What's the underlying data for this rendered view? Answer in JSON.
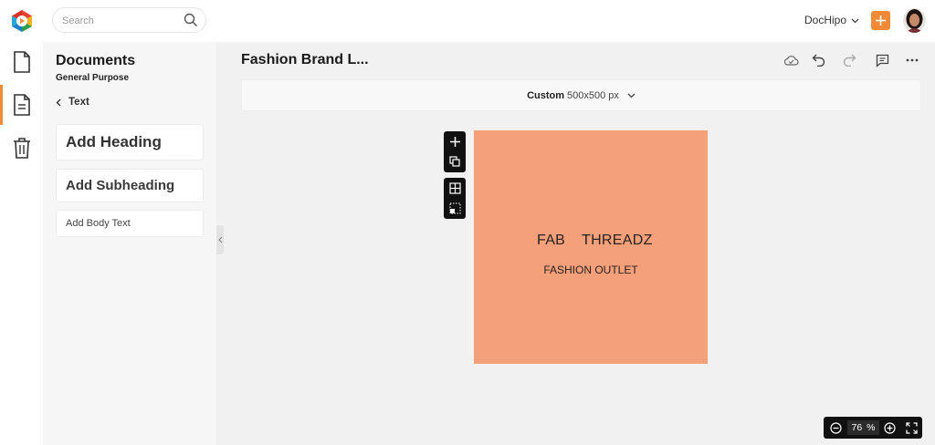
{
  "topbar": {
    "search_placeholder": "Search",
    "team_label": "DocHipo",
    "accent_color": "#f08a36"
  },
  "rail": {
    "items": [
      {
        "icon": "document-icon",
        "active": false
      },
      {
        "icon": "text-document-icon",
        "active": true
      },
      {
        "icon": "trash-icon",
        "active": false
      }
    ]
  },
  "panel": {
    "title": "Documents",
    "subtitle": "General Purpose",
    "back_label": "Text",
    "add_heading": "Add Heading",
    "add_subheading": "Add Subheading",
    "add_body": "Add Body Text"
  },
  "editor": {
    "doc_title": "Fashion Brand L...",
    "size_label": "Custom",
    "size_value": "500x500 px",
    "toolbar_icons": [
      "cloud-sync-icon",
      "undo-icon",
      "redo-icon",
      "comment-icon",
      "more-icon"
    ]
  },
  "design": {
    "background": "#f4a07a",
    "brand_word_1": "FAB",
    "brand_word_2": "THREADZ",
    "tagline": "FASHION OUTLET"
  },
  "zoom": {
    "value": "76",
    "unit": "%"
  }
}
